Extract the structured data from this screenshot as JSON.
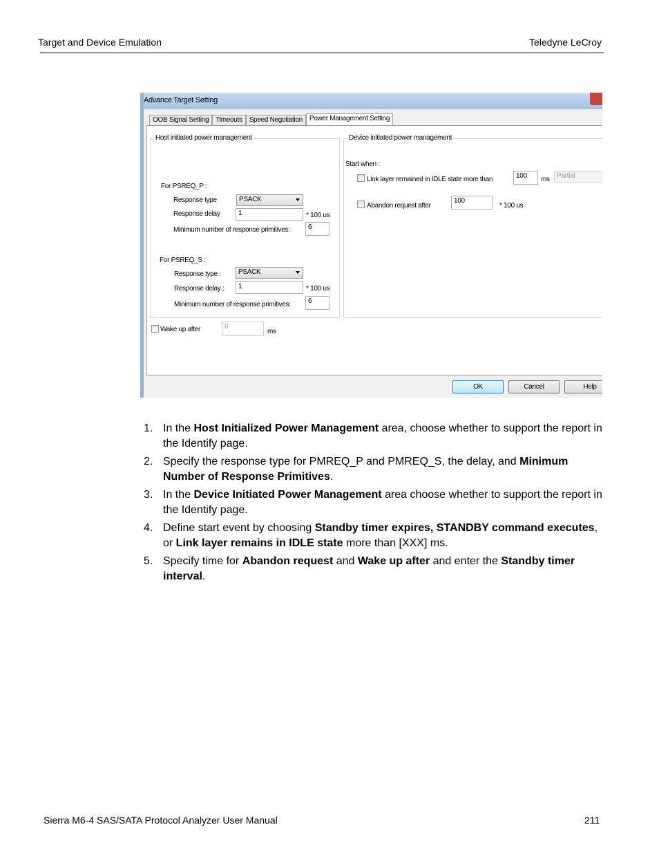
{
  "page_header": {
    "left": "Target and Device Emulation",
    "right": "Teledyne LeCroy"
  },
  "page_footer": {
    "left": "Sierra M6-4 SAS/SATA Protocol Analyzer User Manual",
    "page_number": "211"
  },
  "dialog": {
    "title": "Advance Target Setting",
    "tabs": [
      {
        "label": "OOB Signal Setting",
        "active": false
      },
      {
        "label": "Timeouts",
        "active": false
      },
      {
        "label": "Speed Negotiation",
        "active": false
      },
      {
        "label": "Power Management Setting",
        "active": true
      }
    ],
    "host_group": {
      "title": "Host initiated power management",
      "psreq_p": {
        "heading": "For PSREQ_P :",
        "response_type_label": "Response type",
        "response_type_value": "PSACK",
        "response_delay_label": "Response delay",
        "response_delay_value": "1",
        "response_delay_unit": "* 100 us",
        "min_primitives_label": "Minimum number of response primitives:",
        "min_primitives_value": "6"
      },
      "psreq_s": {
        "heading": "For PSREQ_S :",
        "response_type_label": "Response type :",
        "response_type_value": "PSACK",
        "response_delay_label": "Response delay :",
        "response_delay_value": "1",
        "response_delay_unit": "* 100 us",
        "min_primitives_label": "Minimum number of response primitives:",
        "min_primitives_value": "6"
      }
    },
    "device_group": {
      "title": "Device initiated power management",
      "start_when_label": "Start when :",
      "link_idle_label": "Link layer remained in IDLE state more than",
      "link_idle_checked": false,
      "link_idle_value": "100",
      "link_idle_unit": "ms",
      "link_idle_mode": "Partial",
      "abandon_label": "Abandon request after",
      "abandon_checked": false,
      "abandon_value": "100",
      "abandon_unit": "* 100 us"
    },
    "wake_up": {
      "label": "Wake up after",
      "checked": false,
      "value": "0",
      "unit": "ms"
    },
    "buttons": {
      "ok": "OK",
      "cancel": "Cancel",
      "help": "Help"
    }
  },
  "steps": [
    {
      "num": "1.",
      "parts": [
        {
          "t": "In the ",
          "b": false
        },
        {
          "t": "Host Initialized Power Management",
          "b": true
        },
        {
          "t": " area, choose whether to support the report in the Identify page.",
          "b": false
        }
      ]
    },
    {
      "num": "2.",
      "parts": [
        {
          "t": "Specify the response type for PMREQ_P and PMREQ_S, the delay, and ",
          "b": false
        },
        {
          "t": "Minimum Number of Response Primitives",
          "b": true
        },
        {
          "t": ".",
          "b": false
        }
      ]
    },
    {
      "num": "3.",
      "parts": [
        {
          "t": "In the ",
          "b": false
        },
        {
          "t": "Device Initiated Power Management",
          "b": true
        },
        {
          "t": " area choose whether to support the report in the Identify page.",
          "b": false
        }
      ]
    },
    {
      "num": "4.",
      "parts": [
        {
          "t": "Define start event by choosing ",
          "b": false
        },
        {
          "t": "Standby timer expires, STANDBY command executes",
          "b": true
        },
        {
          "t": ", or ",
          "b": false
        },
        {
          "t": "Link layer remains in IDLE state",
          "b": true
        },
        {
          "t": " more than [XXX] ms.",
          "b": false
        }
      ]
    },
    {
      "num": "5.",
      "parts": [
        {
          "t": "Specify time for ",
          "b": false
        },
        {
          "t": "Abandon request",
          "b": true
        },
        {
          "t": " and ",
          "b": false
        },
        {
          "t": "Wake up after",
          "b": true
        },
        {
          "t": " and enter the ",
          "b": false
        },
        {
          "t": "Standby timer interval",
          "b": true
        },
        {
          "t": ".",
          "b": false
        }
      ]
    }
  ]
}
